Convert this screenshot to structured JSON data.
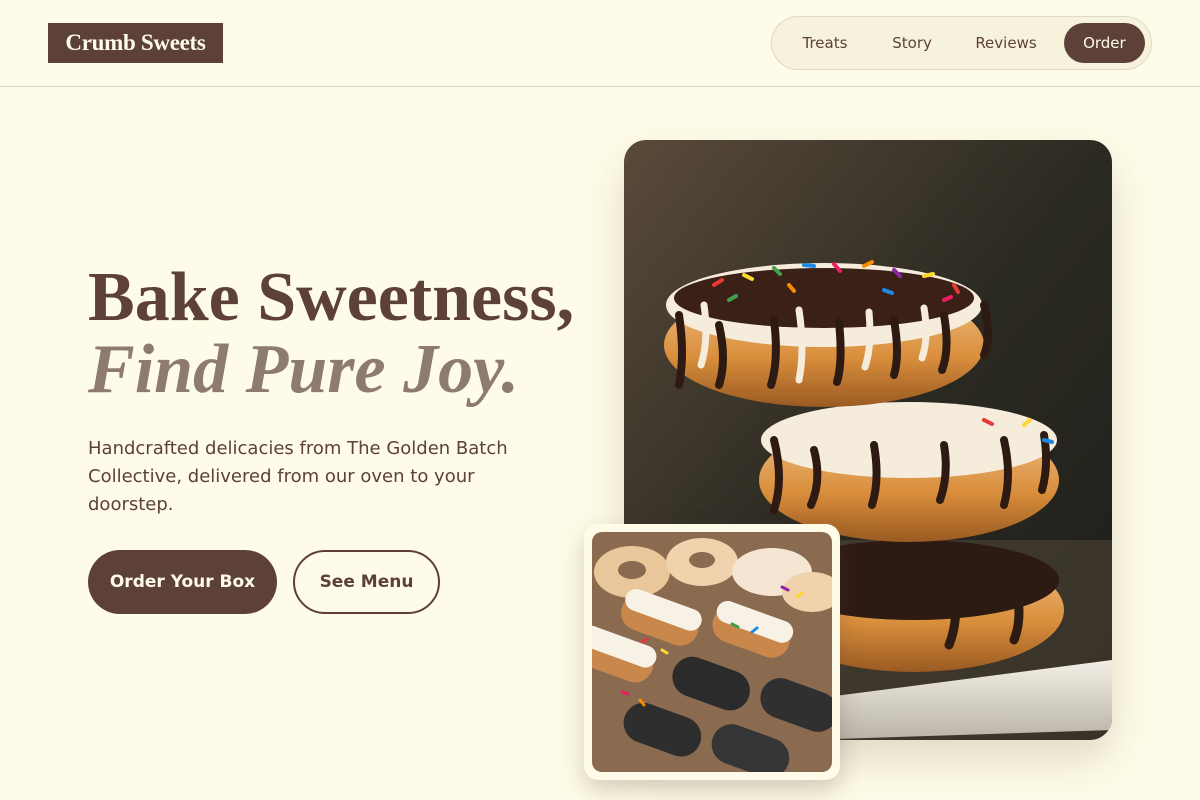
{
  "brand": {
    "name": "Crumb Sweets"
  },
  "nav": {
    "items": [
      {
        "label": "Treats"
      },
      {
        "label": "Story"
      },
      {
        "label": "Reviews"
      },
      {
        "label": "Order"
      }
    ],
    "active": "Order"
  },
  "hero": {
    "headline_line1": "Bake Sweetness,",
    "headline_line2": "Find Pure Joy.",
    "description": "Handcrafted delicacies from The Golden Batch Collective, delivered from our oven to your doorstep.",
    "primary_cta": "Order Your Box",
    "secondary_cta": "See Menu"
  },
  "colors": {
    "background": "#fefce8",
    "brand": "#5d4037",
    "accent_muted": "#8d7a70"
  },
  "images": {
    "main": "stacked-glazed-donuts-photo",
    "thumbnail": "donut-tray-photo"
  }
}
